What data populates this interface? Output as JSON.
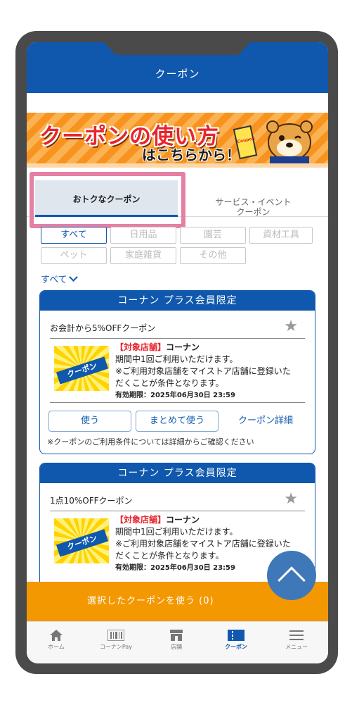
{
  "header": {
    "title": "クーポン"
  },
  "banner": {
    "line1": "クーポンの使い方",
    "line2": "はこちらから！",
    "card_text": "Coupon"
  },
  "tabs": [
    {
      "label": "おトクなクーポン",
      "active": true
    },
    {
      "label": "サービス・イベント\nクーポン",
      "active": false
    }
  ],
  "filters": [
    "すべて",
    "日用品",
    "園芸",
    "資材工具",
    "ペット",
    "家庭雑貨",
    "その他"
  ],
  "active_filter": "すべて",
  "all_link": "すべて",
  "coupons": [
    {
      "header": "コーナン プラス会員限定",
      "name": "お会計から5%OFFクーポン",
      "thumb_label": "クーポン",
      "store_tag": "【対象店舗】",
      "store": "コーナン",
      "desc1": "期間中1回ご利用いただけます。",
      "desc2": "※ご利用対象店舗をマイストア店舗に登録いた",
      "desc3": "だくことが条件となります。",
      "expiry": "有効期限：2025年06月30日 23:59",
      "use_label": "使う",
      "bulk_label": "まとめて使う",
      "detail_label": "クーポン詳細",
      "note": "※クーポンのご利用条件については詳細からご確認ください"
    },
    {
      "header": "コーナン プラス会員限定",
      "name": "1点10%OFFクーポン",
      "thumb_label": "クーポン",
      "store_tag": "【対象店舗】",
      "store": "コーナン",
      "desc1": "期間中1回ご利用いただけます。",
      "desc2": "※ご利用対象店舗をマイストア店舗に登録いた",
      "desc3": "だくことが条件となります。",
      "expiry": "有効期限：2025年06月30日 23:59"
    }
  ],
  "use_selected": "選択したクーポンを使う (0)",
  "nav": [
    {
      "label": "ホーム",
      "icon": "home-icon"
    },
    {
      "label": "コーナンPay",
      "icon": "barcode-icon"
    },
    {
      "label": "店舗",
      "icon": "store-icon"
    },
    {
      "label": "クーポン",
      "icon": "coupon-icon",
      "active": true
    },
    {
      "label": "メニュー",
      "icon": "menu-icon"
    }
  ],
  "colors": {
    "brand": "#0f58ad",
    "orange": "#f39800",
    "red": "#e8242d",
    "highlight": "#e57fa3"
  }
}
